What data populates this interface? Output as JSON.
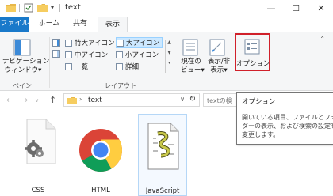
{
  "window": {
    "title": "text",
    "minimize": "—",
    "maximize": "☐",
    "close": "✕"
  },
  "ribbon_tabs": {
    "file": "ファイル",
    "home": "ホーム",
    "share": "共有",
    "view": "表示"
  },
  "pane_group": {
    "nav_pane_line1": "ナビゲーション",
    "nav_pane_line2": "ウィンドウ▾",
    "label": "ペイン"
  },
  "layout_group": {
    "items": [
      "特大アイコン",
      "大アイコン",
      "中アイコン",
      "小アイコン",
      "一覧",
      "詳細"
    ],
    "selected": "大アイコン",
    "label": "レイアウト"
  },
  "view_group": {
    "current_view_line1": "現在の",
    "current_view_line2": "ビュー▾",
    "show_hide_line1": "表示/非",
    "show_hide_line2": "表示▾",
    "options": "オプション"
  },
  "address": {
    "path": "text",
    "search_placeholder": "textの検"
  },
  "files": [
    {
      "name": "CSS"
    },
    {
      "name": "HTML"
    },
    {
      "name": "JavaScript"
    }
  ],
  "tooltip": {
    "title": "オプション",
    "body": "開いている項目、ファイルとフォル\nダーの表示、および検索の設定を\n変更します。"
  },
  "colors": {
    "file_tab": "#1979ca",
    "highlight_border": "#d0202a",
    "selection": "#cce8ff"
  }
}
